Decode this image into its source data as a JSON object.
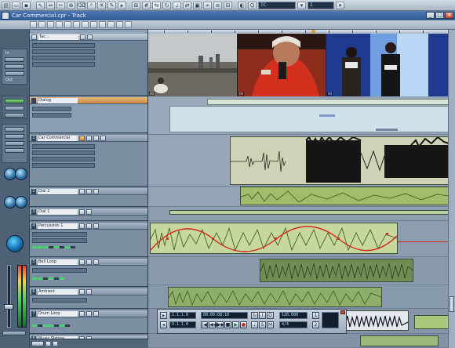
{
  "app": {
    "toolbar_field_a": "TC",
    "toolbar_field_b": "1"
  },
  "window": {
    "title": "Car Commercial.cpr - Track",
    "minimize": "_",
    "maximize": "□",
    "close": "×"
  },
  "inspector": {
    "label_a": "In",
    "label_b": "Out"
  },
  "tracks": [
    {
      "num": "",
      "name": "Dialog"
    },
    {
      "num": "1",
      "name": "Car Commercial"
    },
    {
      "num": "2",
      "name": "Dial 2"
    },
    {
      "num": "3",
      "name": "Dial 1"
    },
    {
      "num": "4",
      "name": "Percussion 1"
    },
    {
      "num": "5",
      "name": "Bell Loop"
    },
    {
      "num": "6",
      "name": "Ambient"
    },
    {
      "num": "7",
      "name": "Drum Loop"
    },
    {
      "num": "8",
      "name": "Music Strings"
    }
  ],
  "video": {
    "timecodes": [
      "00",
      "00",
      "00"
    ]
  },
  "transport": {
    "left_locator": "1.1.1.0",
    "position": "00:00:08:10",
    "right_locator": "9.1.1.0",
    "tempo": "120.000",
    "signature": "4/4",
    "buttons": [
      "|◀",
      "◀◀",
      "▶▶",
      "■",
      "▶",
      "●"
    ]
  }
}
